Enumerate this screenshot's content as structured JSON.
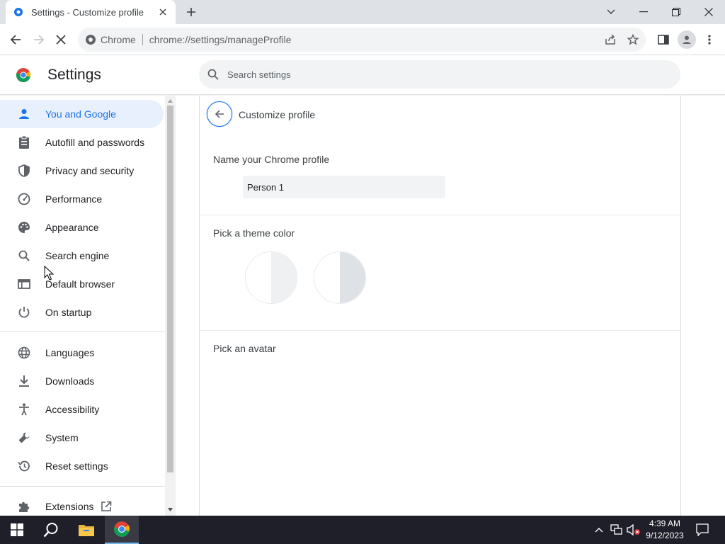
{
  "browser": {
    "tab_title": "Settings - Customize profile",
    "omnibox_site": "Chrome",
    "omnibox_url": "chrome://settings/manageProfile"
  },
  "settings": {
    "title": "Settings",
    "search_placeholder": "Search settings"
  },
  "sidebar": {
    "items": [
      {
        "label": "You and Google",
        "icon": "person-icon",
        "active": true
      },
      {
        "label": "Autofill and passwords",
        "icon": "clipboard-icon"
      },
      {
        "label": "Privacy and security",
        "icon": "shield-icon"
      },
      {
        "label": "Performance",
        "icon": "speedometer-icon"
      },
      {
        "label": "Appearance",
        "icon": "palette-icon"
      },
      {
        "label": "Search engine",
        "icon": "search-icon"
      },
      {
        "label": "Default browser",
        "icon": "browser-window-icon"
      },
      {
        "label": "On startup",
        "icon": "power-icon"
      },
      {
        "label": "Languages",
        "icon": "globe-icon"
      },
      {
        "label": "Downloads",
        "icon": "download-icon"
      },
      {
        "label": "Accessibility",
        "icon": "accessibility-icon"
      },
      {
        "label": "System",
        "icon": "wrench-icon"
      },
      {
        "label": "Reset settings",
        "icon": "history-icon"
      },
      {
        "label": "Extensions",
        "icon": "puzzle-icon"
      }
    ]
  },
  "main": {
    "page_title": "Customize profile",
    "name_section_label": "Name your Chrome profile",
    "profile_name_value": "Person 1",
    "theme_section_label": "Pick a theme color",
    "avatar_section_label": "Pick an avatar",
    "theme_swatches": [
      {
        "left": "#ffffff",
        "right": "#eef0f2"
      },
      {
        "left": "#ffffff",
        "right": "#dee1e6"
      }
    ]
  },
  "taskbar": {
    "time": "4:39 AM",
    "date": "9/12/2023"
  },
  "colors": {
    "accent": "#1a73e8",
    "active_nav_bg": "#e8f0fe",
    "taskbar": "#1f1f2a"
  }
}
